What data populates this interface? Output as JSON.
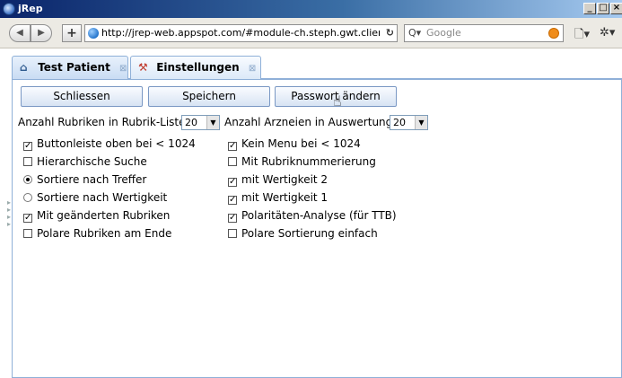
{
  "window": {
    "title": "jRep",
    "buttons": [
      "_",
      "□",
      "×"
    ]
  },
  "browser": {
    "back_icon": "back-arrow-icon",
    "forward_icon": "forward-arrow-icon",
    "new_tab_label": "+",
    "url": "http://jrep-web.appspot.com/#module-ch.steph.gwt.client.ui.vie",
    "search_placeholder": "Google"
  },
  "tabs": [
    {
      "label": "Test Patient",
      "icon": "home-icon",
      "close": "⊠"
    },
    {
      "label": "Einstellungen",
      "icon": "settings-icon",
      "close": "⊠"
    }
  ],
  "actions": {
    "close_label": "Schliessen",
    "save_label": "Speichern",
    "password_label": "Passwort ändern"
  },
  "settings": {
    "rubrik_count_label": "Anzahl Rubriken in Rubrik-Liste",
    "rubrik_count_value": "20",
    "arznei_count_label": "Anzahl Arzneien in Auswertung",
    "arznei_count_value": "20"
  },
  "options_left": [
    {
      "label": "Buttonleiste oben bei < 1024",
      "type": "checkbox",
      "checked": true
    },
    {
      "label": "Hierarchische Suche",
      "type": "checkbox",
      "checked": false
    },
    {
      "label": "Sortiere nach Treffer",
      "type": "radio",
      "checked": true
    },
    {
      "label": "Sortiere nach Wertigkeit",
      "type": "radio",
      "checked": false
    },
    {
      "label": "Mit geänderten Rubriken",
      "type": "checkbox",
      "checked": true
    },
    {
      "label": "Polare Rubriken am Ende",
      "type": "checkbox",
      "checked": false
    }
  ],
  "options_right": [
    {
      "label": "Kein Menu bei < 1024",
      "type": "checkbox",
      "checked": true
    },
    {
      "label": "Mit Rubriknummerierung",
      "type": "checkbox",
      "checked": false
    },
    {
      "label": "mit Wertigkeit 2",
      "type": "checkbox",
      "checked": true
    },
    {
      "label": "mit Wertigkeit 1",
      "type": "checkbox",
      "checked": true
    },
    {
      "label": "Polaritäten-Analyse (für TTB)",
      "type": "checkbox",
      "checked": true
    },
    {
      "label": "Polare Sortierung einfach",
      "type": "checkbox",
      "checked": false
    }
  ]
}
